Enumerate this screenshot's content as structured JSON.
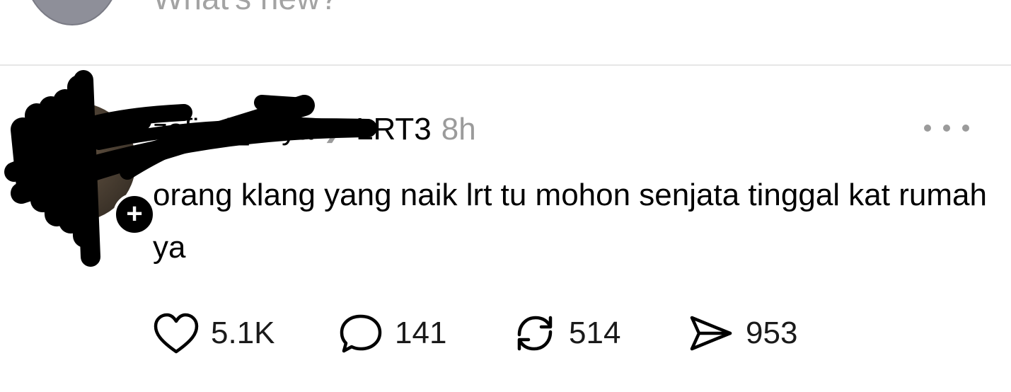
{
  "composer": {
    "placeholder": "What's new?"
  },
  "post": {
    "username": "zafirul_haya",
    "community": "LRT3",
    "time": "8h",
    "text": "orang klang yang naik lrt tu mohon senjata tinggal kat rumah ya",
    "actions": {
      "likes": "5.1K",
      "replies": "141",
      "reposts": "514",
      "shares": "953"
    }
  },
  "icons": {
    "like": "heart-icon",
    "reply": "comment-icon",
    "repost": "repost-icon",
    "share": "send-icon",
    "more": "more-dots-icon",
    "follow": "plus-icon",
    "chevron": "chevron-right-icon"
  }
}
